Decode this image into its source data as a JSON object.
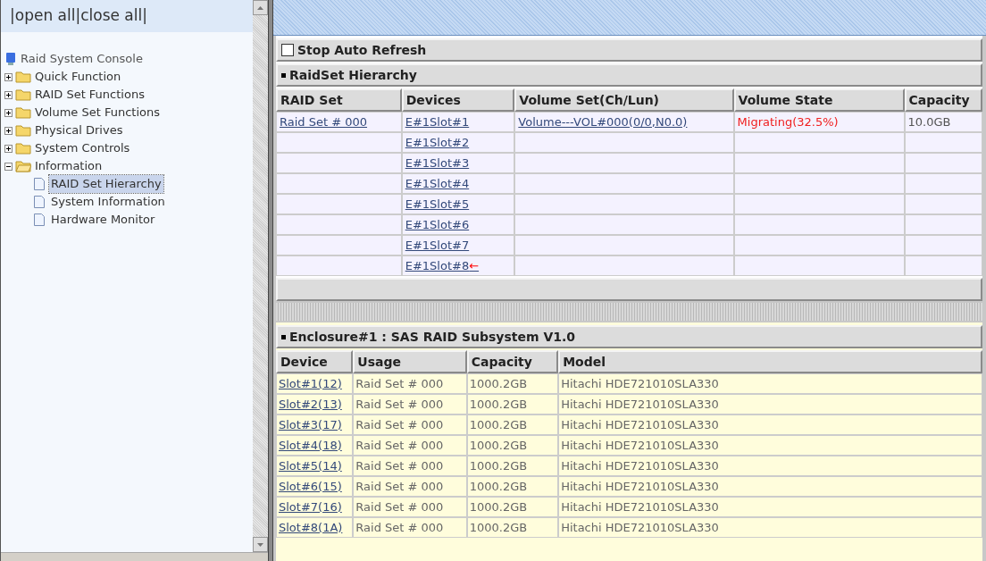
{
  "top_links": [
    {
      "label": "|open all|"
    },
    {
      "label": "close all|"
    }
  ],
  "tree": {
    "label": "Raid System Console",
    "children": [
      {
        "label": "Quick Function",
        "expanded": false,
        "selected": false
      },
      {
        "label": "RAID Set Functions",
        "expanded": false,
        "selected": false
      },
      {
        "label": "Volume Set Functions",
        "expanded": false,
        "selected": false
      },
      {
        "label": "Physical Drives",
        "expanded": false,
        "selected": false
      },
      {
        "label": "System Controls",
        "expanded": false,
        "selected": false
      },
      {
        "label": "Information",
        "expanded": true,
        "selected": false,
        "children": [
          {
            "label": "RAID Set Hierarchy",
            "selected": true
          },
          {
            "label": "System Information",
            "selected": false
          },
          {
            "label": "Hardware Monitor",
            "selected": false
          }
        ]
      }
    ]
  },
  "auto_refresh": {
    "label": "Stop Auto Refresh",
    "checked": false
  },
  "raidset": {
    "title": "RaidSet Hierarchy",
    "columns": [
      "RAID Set",
      "Devices",
      "Volume Set(Ch/Lun)",
      "Volume State",
      "Capacity"
    ],
    "rows": [
      {
        "raid_set": "Raid Set # 000",
        "device": "E#1Slot#1",
        "volume": "Volume---VOL#000(0/0,N0.0)",
        "state": "Migrating(32.5%)",
        "capacity": "10.0GB"
      },
      {
        "device": "E#1Slot#2"
      },
      {
        "device": "E#1Slot#3"
      },
      {
        "device": "E#1Slot#4"
      },
      {
        "device": "E#1Slot#5"
      },
      {
        "device": "E#1Slot#6"
      },
      {
        "device": "E#1Slot#7"
      },
      {
        "device": "E#1Slot#8",
        "marker": "←"
      }
    ]
  },
  "enclosure": {
    "title": "Enclosure#1 : SAS RAID Subsystem V1.0",
    "columns": [
      "Device",
      "Usage",
      "Capacity",
      "Model"
    ],
    "rows": [
      {
        "device": "Slot#1(12)",
        "usage": "Raid Set # 000",
        "capacity": "1000.2GB",
        "model": "Hitachi HDE721010SLA330"
      },
      {
        "device": "Slot#2(13)",
        "usage": "Raid Set # 000",
        "capacity": "1000.2GB",
        "model": "Hitachi HDE721010SLA330"
      },
      {
        "device": "Slot#3(17)",
        "usage": "Raid Set # 000",
        "capacity": "1000.2GB",
        "model": "Hitachi HDE721010SLA330"
      },
      {
        "device": "Slot#4(18)",
        "usage": "Raid Set # 000",
        "capacity": "1000.2GB",
        "model": "Hitachi HDE721010SLA330"
      },
      {
        "device": "Slot#5(14)",
        "usage": "Raid Set # 000",
        "capacity": "1000.2GB",
        "model": "Hitachi HDE721010SLA330"
      },
      {
        "device": "Slot#6(15)",
        "usage": "Raid Set # 000",
        "capacity": "1000.2GB",
        "model": "Hitachi HDE721010SLA330"
      },
      {
        "device": "Slot#7(16)",
        "usage": "Raid Set # 000",
        "capacity": "1000.2GB",
        "model": "Hitachi HDE721010SLA330"
      },
      {
        "device": "Slot#8(1A)",
        "usage": "Raid Set # 000",
        "capacity": "1000.2GB",
        "model": "Hitachi HDE721010SLA330"
      }
    ]
  }
}
